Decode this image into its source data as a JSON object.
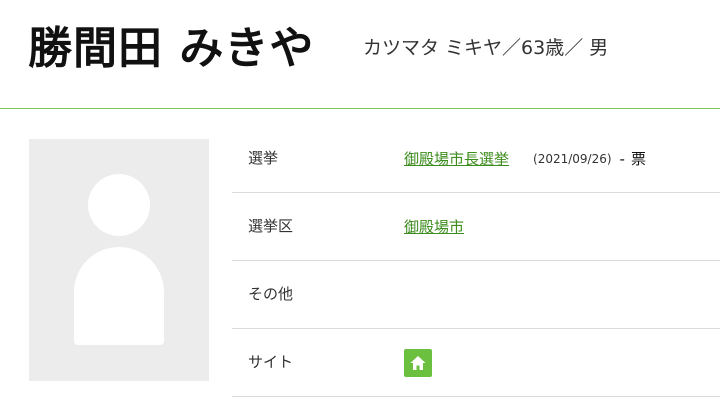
{
  "profile": {
    "name": "勝間田 みきや",
    "reading": "カツマタ ミキヤ／63歳／ 男"
  },
  "photo": {
    "alt": "avatar placeholder"
  },
  "details": {
    "election_label": "選挙",
    "election_link": "御殿場市長選挙",
    "election_date": "(2021/09/26)",
    "election_dash": "-",
    "election_votes": "票",
    "district_label": "選挙区",
    "district_link": "御殿場市",
    "other_label": "その他",
    "site_label": "サイト",
    "site_icon": "home-icon"
  },
  "colors": {
    "accent": "#7cc35a",
    "link": "#3c8c1e",
    "home_button": "#6cc040"
  }
}
